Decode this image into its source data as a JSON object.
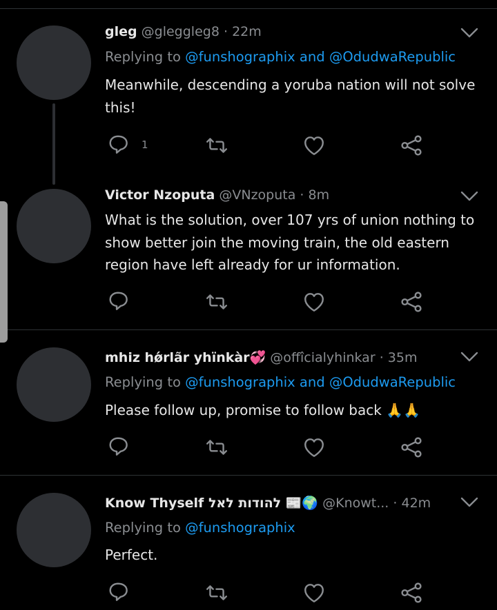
{
  "tweets": [
    {
      "name": "gleg",
      "handle": "@gleggleg8",
      "sep": "·",
      "time": "22m",
      "replying_prefix": "Replying to",
      "mention1": "@funshographix",
      "and": "and",
      "mention2": "@OdudwaRepublic",
      "text": "Meanwhile, descending a yoruba nation will not solve this!",
      "reply_count": "1"
    },
    {
      "name": "Victor Nzoputa",
      "handle": "@VNzoputa",
      "sep": "·",
      "time": "8m",
      "text": "What is the solution, over 107 yrs of union nothing to show better join the moving train, the old eastern region have left already for ur information."
    },
    {
      "name": "mhiz hǿrlãr yhïnkàr💞",
      "handle": "@offîcialyhinkar",
      "sep": "·",
      "time": "35m",
      "replying_prefix": "Replying to",
      "mention1": "@funshographix",
      "and": "and",
      "mention2": "@OdudwaRepublic",
      "text": "Please follow up, promise to follow back 🙏🙏"
    },
    {
      "name": "Know Thyself להודות לאל 📰🌍",
      "handle": "@Knowt...",
      "sep": "·",
      "time": "42m",
      "replying_prefix": "Replying to",
      "mention1": "@funshographix",
      "text": "Perfect."
    }
  ],
  "icons": [
    "reply-icon",
    "retweet-icon",
    "like-icon",
    "share-icon",
    "chevron-down-icon"
  ],
  "colors": {
    "background": "#000000",
    "link": "#1d9bf0",
    "muted": "#8a8d91",
    "text": "#e7e7e7"
  }
}
